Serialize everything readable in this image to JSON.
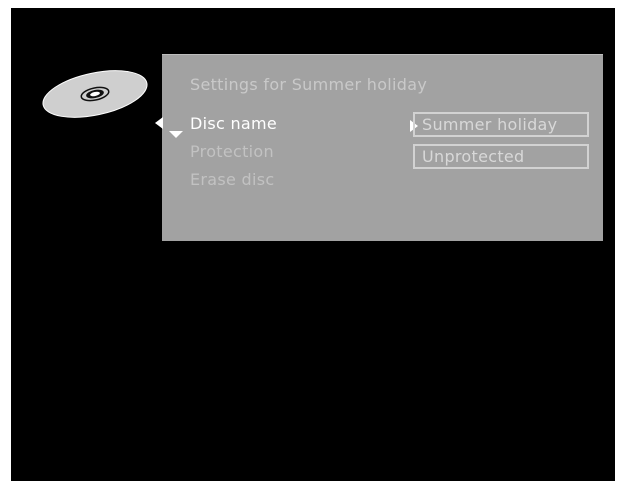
{
  "panel": {
    "title": "Settings for Summer holiday"
  },
  "menu": {
    "items": [
      {
        "label": "Disc name",
        "selected": true
      },
      {
        "label": "Protection",
        "selected": false
      },
      {
        "label": "Erase disc",
        "selected": false
      }
    ]
  },
  "fields": {
    "disc_name": "Summer holiday",
    "protection": "Unprotected"
  },
  "icons": {
    "disc": "disc-icon",
    "left": "triangle-left-icon",
    "down": "triangle-down-icon",
    "pointer": "triangle-right-icon"
  },
  "colors": {
    "background": "#000000",
    "panel": "#a2a2a2",
    "selected_text": "#ffffff",
    "inactive_text": "#c2c2c2"
  }
}
